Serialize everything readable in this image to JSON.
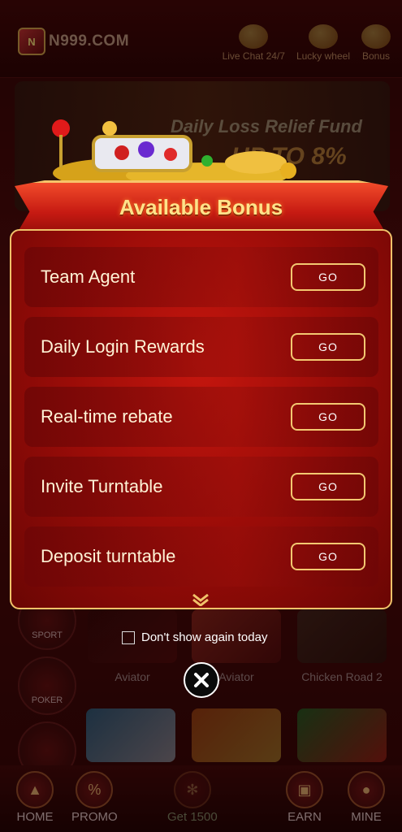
{
  "app": {
    "logo_badge": "N",
    "logo_text": "N999.COM",
    "top_nav": [
      {
        "label": "Live Chat 24/7",
        "icon": "headset-icon"
      },
      {
        "label": "Lucky wheel",
        "icon": "wheel-icon"
      },
      {
        "label": "Bonus",
        "icon": "gift-icon"
      }
    ],
    "banner": {
      "title": "Daily Loss Relief Fund",
      "subtitle": "UP TO 8%"
    },
    "categories": [
      "SPORT",
      "POKER"
    ],
    "games": [
      "Aviator",
      "Aviator",
      "Chicken Road 2"
    ],
    "bottom_nav": [
      {
        "label": "HOME",
        "icon": "home-icon"
      },
      {
        "label": "PROMO",
        "icon": "promo-icon"
      },
      {
        "label": "Get 1500",
        "icon": "wheel-icon"
      },
      {
        "label": "EARN",
        "icon": "gift-icon"
      },
      {
        "label": "MINE",
        "icon": "user-icon"
      }
    ]
  },
  "modal": {
    "title": "Available Bonus",
    "go_label": "GO",
    "items": [
      {
        "label": "Team Agent"
      },
      {
        "label": "Daily Login Rewards"
      },
      {
        "label": "Real-time rebate"
      },
      {
        "label": "Invite Turntable"
      },
      {
        "label": "Deposit turntable"
      }
    ],
    "dont_show_label": "Don't show again today",
    "dont_show_checked": false
  },
  "colors": {
    "panel_red": "#b0120c",
    "gold_border": "#f0c26a",
    "title_gold": "#ffe38a"
  }
}
